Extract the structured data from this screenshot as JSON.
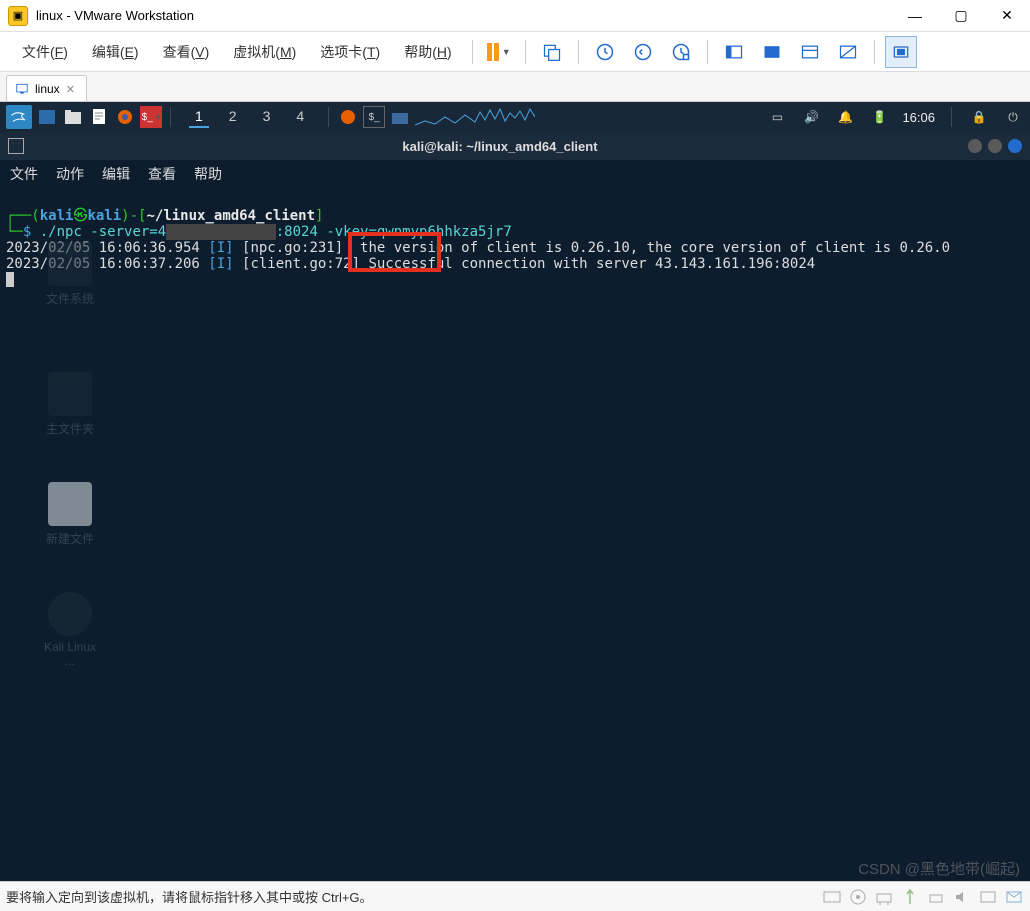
{
  "titlebar": {
    "icon": "▣",
    "text": "linux - VMware Workstation"
  },
  "menubar": {
    "items": [
      {
        "label": "文件(",
        "key": "F",
        "suffix": ")"
      },
      {
        "label": "编辑(",
        "key": "E",
        "suffix": ")"
      },
      {
        "label": "查看(",
        "key": "V",
        "suffix": ")"
      },
      {
        "label": "虚拟机(",
        "key": "M",
        "suffix": ")"
      },
      {
        "label": "选项卡(",
        "key": "T",
        "suffix": ")"
      },
      {
        "label": "帮助(",
        "key": "H",
        "suffix": ")"
      }
    ]
  },
  "tab": {
    "label": "linux"
  },
  "kali": {
    "workspaces": [
      "1",
      "2",
      "3",
      "4"
    ],
    "clock": "16:06"
  },
  "term": {
    "title": "kali@kali: ~/linux_amd64_client",
    "menu": [
      "文件",
      "动作",
      "编辑",
      "查看",
      "帮助"
    ],
    "prompt_open": "(",
    "user": "kali",
    "at": "㉿",
    "host": "kali",
    "prompt_close": ")-[",
    "path": "~/linux_amd64_client",
    "bracket_close": "]",
    "prompt_sym": "$",
    "cmd": "./npc -server=4",
    "cmd_mask": "             ",
    "cmd_tail": ":8024 -vkey=qwnmyp6hhkza5jr7",
    "line1_ts": "2023/02/05 16:06:36.954 ",
    "line1_lvl": "[I]",
    "line1_src": " [npc.go:231]  the version of client is 0.26.10, the core version of client is 0.26.0",
    "line2_ts": "2023/02/05 16:06:37.206 ",
    "line2_lvl": "[I]",
    "line2_src": " [client.go:72] ",
    "line2_success": "Successful ",
    "line2_rest": "connection with server 43.143.161.196:8024"
  },
  "statusbar": {
    "text": "要将输入定向到该虚拟机，请将鼠标指针移入其中或按 Ctrl+G。"
  },
  "watermark": "CSDN @黑色地带(崛起)"
}
